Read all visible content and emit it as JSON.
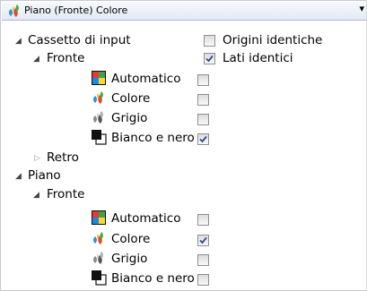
{
  "header": {
    "title": "Piano (Fronte) Colore"
  },
  "tree": {
    "cassetto": {
      "label": "Cassetto di input",
      "option1": {
        "label": "Origini identiche",
        "checked": false
      },
      "option2": {
        "label": "Lati identici",
        "checked": true
      },
      "fronte": {
        "label": "Fronte",
        "items": [
          {
            "label": "Automatico",
            "checked": false
          },
          {
            "label": "Colore",
            "checked": false
          },
          {
            "label": "Grigio",
            "checked": false
          },
          {
            "label": "Bianco e nero",
            "checked": true
          }
        ]
      },
      "retro": {
        "label": "Retro"
      }
    },
    "piano": {
      "label": "Piano",
      "fronte": {
        "label": "Fronte",
        "items": [
          {
            "label": "Automatico",
            "checked": false
          },
          {
            "label": "Colore",
            "checked": true
          },
          {
            "label": "Grigio",
            "checked": false
          },
          {
            "label": "Bianco e nero",
            "checked": false
          }
        ]
      }
    }
  }
}
